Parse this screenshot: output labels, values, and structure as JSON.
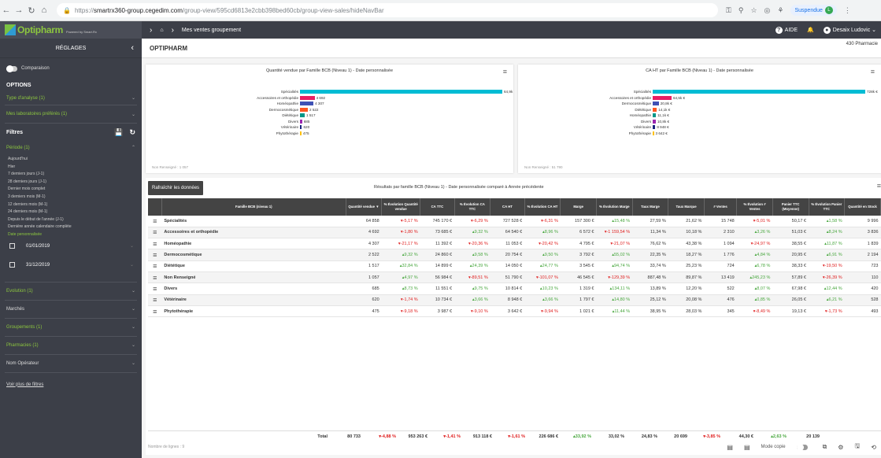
{
  "browser": {
    "url_prefix": "https://",
    "url_host": "smartrx360-group.cegedim.com",
    "url_path": "/group-view/595cd6813e2cbb398bed60cb/group-view-sales/hideNavBar",
    "profile": "Suspendue",
    "profile_initial": "L"
  },
  "header": {
    "logo": "Optipharm",
    "logo_sub": "Powered by Smart.Rx",
    "crumb": "Mes ventes groupement",
    "help": "AIDE",
    "user": "Desaix Ludovic"
  },
  "sidebar": {
    "title": "RÉGLAGES",
    "comparison": "Comparaison",
    "options": "OPTIONS",
    "analysis_type": "Type d'analyse (1)",
    "labs": "Mes laboratoires préférés (1)",
    "filters": "Filtres",
    "period": "Période (1)",
    "periods": [
      "Aujourd'hui",
      "Hier",
      "7 derniers jours (J-1)",
      "28 derniers jours (J-1)",
      "Dernier mois complet",
      "3 derniers mois (M-1)",
      "12 derniers mois (M-1)",
      "24 derniers mois (M-1)",
      "Depuis le début de l'année (J-1)",
      "Dernière année calendaire complète",
      "Date personnalisée"
    ],
    "date_start": "01/01/2019",
    "date_end": "31/12/2019",
    "evolution": "Evolution (1)",
    "markets": "Marchés",
    "groups": "Groupements (1)",
    "pharmacies": "Pharmacies (1)",
    "operator": "Nom Opérateur",
    "more_filters": "Voir plus de filtres"
  },
  "main": {
    "title": "OPTIPHARM",
    "pharmacy_count": "430 Pharmacie"
  },
  "chart1": {
    "title": "Quantité vendue par Famille BCB (Niveau 1) - Date personnalisée",
    "footnote": "Non Renseigné : 1 057",
    "chart_data": {
      "type": "bar",
      "categories": [
        "Spécialités",
        "Accessoires et orthopédie",
        "Homéopathie",
        "Dermocosmétique",
        "Diététique",
        "Divers",
        "Vétérinaire",
        "Phytothérapie"
      ],
      "values": [
        64858,
        4692,
        4307,
        2522,
        1517,
        685,
        620,
        475
      ],
      "labels": [
        "64,9k",
        "4 692",
        "4 307",
        "2 522",
        "1 517",
        "685",
        "620",
        "475"
      ],
      "colors": [
        "#00bcd4",
        "#e91e63",
        "#3f51b5",
        "#ff5722",
        "#009688",
        "#9c27b0",
        "#1a237e",
        "#ffc107"
      ],
      "title": "Quantité vendue par Famille BCB (Niveau 1) - Date personnalisée"
    }
  },
  "chart2": {
    "title": "CA HT par Famille BCB (Niveau 1) - Date personnalisée",
    "footnote": "Non Renseigné : 51 790",
    "chart_data": {
      "type": "bar",
      "categories": [
        "Spécialités",
        "Accessoires et orthopédie",
        "Dermocosmétique",
        "Diététique",
        "Homéopathie",
        "Divers",
        "Vétérinaire",
        "Phytothérapie"
      ],
      "values": [
        727528,
        64540,
        20754,
        14050,
        11053,
        10814,
        8948,
        3642
      ],
      "labels": [
        "728k €",
        "64,5k €",
        "20,8k €",
        "14,1k €",
        "11,1k €",
        "10,8k €",
        "8 948 €",
        "3 642 €"
      ],
      "colors": [
        "#00bcd4",
        "#e91e63",
        "#3f51b5",
        "#ff5722",
        "#009688",
        "#9c27b0",
        "#1a237e",
        "#ffc107"
      ],
      "title": "CA HT par Famille BCB (Niveau 1) - Date personnalisée"
    }
  },
  "table": {
    "refresh": "Rafraîchir les données",
    "title": "Résultats par famille BCB (Niveau 1) - Date personnalisée comparé à Année précédente",
    "columns": [
      "Famille BCB (niveau 1)",
      "Quantité vendue ▼",
      "% Évolution Quantité vendue",
      "CA TTC",
      "% Évolution CA TTC",
      "CA HT",
      "% Évolution CA HT",
      "Marge",
      "% Évolution Marge",
      "Taux Marge",
      "Taux Marque",
      "# Ventes",
      "% Évolution # Ventes",
      "Panier TTC (Moyenne)",
      "% Évolution Panier TTC",
      "Quantité en Stock"
    ],
    "rows": [
      [
        "Spécialités",
        "64 858",
        "▾-5,17 %",
        "745 170 €",
        "▾-6,29 %",
        "727 528 €",
        "▾-6,31 %",
        "157 300 €",
        "▴15,48 %",
        "27,59 %",
        "21,62 %",
        "15 748",
        "▾-5,01 %",
        "50,17 €",
        "▴1,58 %",
        "9 996"
      ],
      [
        "Accessoires et orthopédie",
        "4 692",
        "▾-1,80 %",
        "73 685 €",
        "▴9,32 %",
        "64 540 €",
        "▴8,96 %",
        "6 572 €",
        "▾-1 159,54 %",
        "11,34 %",
        "10,18 %",
        "2 310",
        "▴3,26 %",
        "51,03 €",
        "▴8,24 %",
        "3 836"
      ],
      [
        "Homéopathie",
        "4 307",
        "▾-21,17 %",
        "11 392 €",
        "▾-20,36 %",
        "11 053 €",
        "▾-20,42 %",
        "4 795 €",
        "▾-21,07 %",
        "76,62 %",
        "43,38 %",
        "1 094",
        "▾-24,97 %",
        "38,55 €",
        "▴11,87 %",
        "1 839"
      ],
      [
        "Dermocosmétique",
        "2 522",
        "▴9,32 %",
        "24 860 €",
        "▴9,58 %",
        "20 754 €",
        "▴9,50 %",
        "3 792 €",
        "▴55,02 %",
        "22,35 %",
        "18,27 %",
        "1 776",
        "▴4,84 %",
        "20,95 €",
        "▴6,91 %",
        "2 194"
      ],
      [
        "Diététique",
        "1 517",
        "▴32,84 %",
        "14 899 €",
        "▴24,39 %",
        "14 050 €",
        "▴24,77 %",
        "3 545 €",
        "▴94,74 %",
        "33,74 %",
        "25,23 %",
        "724",
        "▴6,78 %",
        "38,33 €",
        "▾-19,50 %",
        "723"
      ],
      [
        "Non Renseigné",
        "1 057",
        "▴4,97 %",
        "56 984 €",
        "▾-89,51 %",
        "51 790 €",
        "▾-101,07 %",
        "46 545 €",
        "▾-129,39 %",
        "887,48 %",
        "89,87 %",
        "13 419",
        "▴245,23 %",
        "57,89 €",
        "▾-26,39 %",
        "110"
      ],
      [
        "Divers",
        "685",
        "▴8,73 %",
        "11 551 €",
        "▴9,75 %",
        "10 814 €",
        "▴10,23 %",
        "1 319 €",
        "▴134,11 %",
        "13,89 %",
        "12,20 %",
        "522",
        "▴8,07 %",
        "67,98 €",
        "▴12,44 %",
        "420"
      ],
      [
        "Vétérinaire",
        "620",
        "▾-1,74 %",
        "10 734 €",
        "▴3,66 %",
        "8 948 €",
        "▴3,66 %",
        "1 797 €",
        "▴14,80 %",
        "25,12 %",
        "20,08 %",
        "476",
        "▴0,85 %",
        "26,05 €",
        "▴6,21 %",
        "528"
      ],
      [
        "Phytothérapie",
        "475",
        "▾-9,18 %",
        "3 987 €",
        "▾-9,10 %",
        "3 642 €",
        "▾-9,94 %",
        "1 021 €",
        "▴11,44 %",
        "38,95 %",
        "28,03 %",
        "345",
        "▾-8,49 %",
        "19,13 €",
        "▾-1,73 %",
        "493"
      ]
    ],
    "total": [
      "Total",
      "80 733",
      "▾-4,88 %",
      "953 263 €",
      "▾-1,41 %",
      "913 118 €",
      "▾-1,61 %",
      "226 686 €",
      "▴33,92 %",
      "33,02 %",
      "24,83 %",
      "20 699",
      "▾-3,85 %",
      "44,30 €",
      "▴2,63 %",
      "20 139"
    ],
    "row_count": "Nombre de lignes : 9",
    "copy_mode": "Mode copie"
  }
}
